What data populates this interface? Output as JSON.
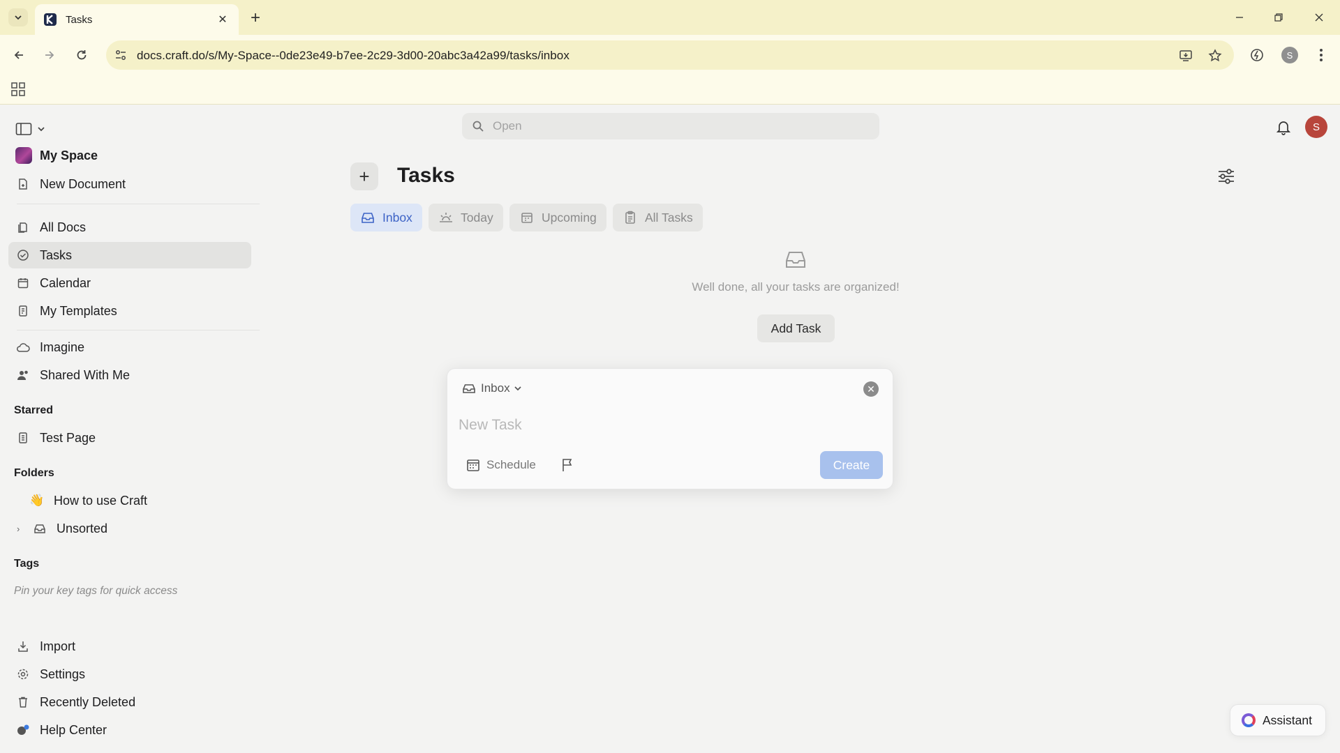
{
  "browser": {
    "tab_title": "Tasks",
    "url": "docs.craft.do/s/My-Space--0de23e49-b7ee-2c29-3d00-20abc3a42a99/tasks/inbox",
    "profile_initial": "S"
  },
  "sidebar": {
    "space_name": "My Space",
    "new_document": "New Document",
    "nav": [
      {
        "label": "All Docs"
      },
      {
        "label": "Tasks"
      },
      {
        "label": "Calendar"
      },
      {
        "label": "My Templates"
      }
    ],
    "imagine": "Imagine",
    "shared": "Shared With Me",
    "starred_heading": "Starred",
    "starred_items": [
      {
        "label": "Test Page"
      }
    ],
    "folders_heading": "Folders",
    "folders": [
      {
        "label": "How to use Craft"
      },
      {
        "label": "Unsorted"
      }
    ],
    "tags_heading": "Tags",
    "tags_hint": "Pin your key tags for quick access",
    "footer": [
      {
        "label": "Import"
      },
      {
        "label": "Settings"
      },
      {
        "label": "Recently Deleted"
      },
      {
        "label": "Help Center"
      }
    ]
  },
  "header": {
    "search_placeholder": "Open",
    "user_initial": "S"
  },
  "main": {
    "title": "Tasks",
    "tabs": [
      {
        "label": "Inbox",
        "active": true
      },
      {
        "label": "Today"
      },
      {
        "label": "Upcoming"
      },
      {
        "label": "All Tasks"
      }
    ],
    "empty_message": "Well done, all your tasks are organized!",
    "add_task_label": "Add Task"
  },
  "modal": {
    "list_label": "Inbox",
    "input_placeholder": "New Task",
    "schedule_label": "Schedule",
    "create_label": "Create"
  },
  "assistant_label": "Assistant",
  "colors": {
    "accent": "#3d63c6",
    "create_disabled": "#a8c1ed",
    "chrome": "#f5f1c9"
  }
}
